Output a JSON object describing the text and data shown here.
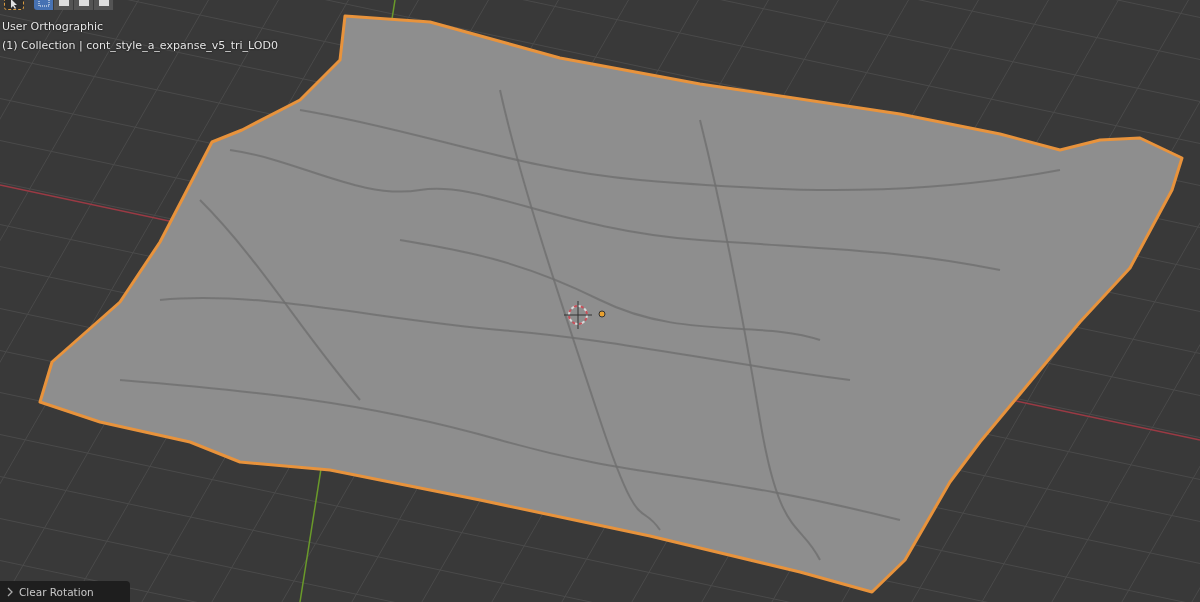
{
  "viewport": {
    "view_name": "User Orthographic",
    "object_info": "(1) Collection | cont_style_a_expanse_v5_tri_LOD0"
  },
  "header_tools": [
    {
      "kind": "tool",
      "selected": true
    },
    {
      "kind": "mode",
      "selected": true
    },
    {
      "kind": "mode",
      "selected": false
    },
    {
      "kind": "mode",
      "selected": false
    },
    {
      "kind": "mode",
      "selected": false
    }
  ],
  "operator_panel": {
    "label": "Clear Rotation",
    "expanded": false
  }
}
